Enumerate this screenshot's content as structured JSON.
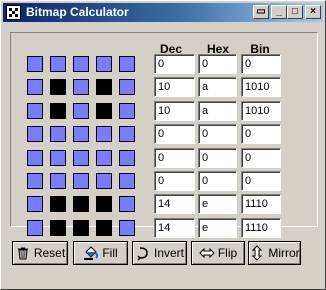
{
  "window": {
    "title": "Bitmap Calculator",
    "controls": {
      "menu": "▭",
      "minimize": "_",
      "maximize": "□",
      "close": "×"
    }
  },
  "headers": {
    "dec": "Dec",
    "hex": "Hex",
    "bin": "Bin"
  },
  "rows": [
    {
      "bits": [
        0,
        0,
        0,
        0,
        0
      ],
      "dec": "0",
      "hex": "0",
      "bin": "0"
    },
    {
      "bits": [
        0,
        1,
        0,
        1,
        0
      ],
      "dec": "10",
      "hex": "a",
      "bin": "1010"
    },
    {
      "bits": [
        0,
        1,
        0,
        1,
        0
      ],
      "dec": "10",
      "hex": "a",
      "bin": "1010"
    },
    {
      "bits": [
        0,
        0,
        0,
        0,
        0
      ],
      "dec": "0",
      "hex": "0",
      "bin": "0"
    },
    {
      "bits": [
        0,
        0,
        0,
        0,
        0
      ],
      "dec": "0",
      "hex": "0",
      "bin": "0"
    },
    {
      "bits": [
        0,
        0,
        0,
        0,
        0
      ],
      "dec": "0",
      "hex": "0",
      "bin": "0"
    },
    {
      "bits": [
        0,
        1,
        1,
        1,
        0
      ],
      "dec": "14",
      "hex": "e",
      "bin": "1110"
    },
    {
      "bits": [
        0,
        1,
        1,
        1,
        0
      ],
      "dec": "14",
      "hex": "e",
      "bin": "1110"
    }
  ],
  "buttons": [
    {
      "name": "reset",
      "label": "Reset",
      "icon": "trash-icon"
    },
    {
      "name": "fill",
      "label": "Fill",
      "icon": "paint-bucket-icon"
    },
    {
      "name": "invert",
      "label": "Invert",
      "icon": "invert-icon"
    },
    {
      "name": "flip",
      "label": "Flip",
      "icon": "flip-arrows-icon"
    },
    {
      "name": "mirror",
      "label": "Mirror",
      "icon": "mirror-arrows-icon"
    }
  ],
  "colors": {
    "bit_off": "#7b7bff",
    "bit_on": "#000000"
  }
}
